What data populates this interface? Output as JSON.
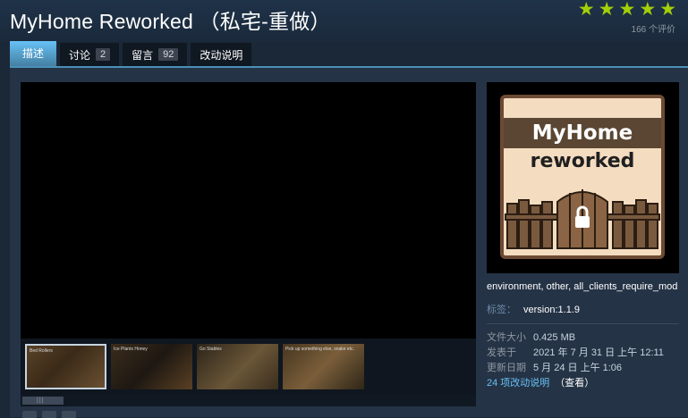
{
  "title": "MyHome Reworked （私宅-重做）",
  "rating": {
    "stars": 5,
    "count_text": "166 个评价",
    "star_color": "#a3cf06"
  },
  "tabs": [
    {
      "label": "描述",
      "active": true
    },
    {
      "label": "讨论",
      "count": "2"
    },
    {
      "label": "留言",
      "count": "92"
    },
    {
      "label": "改动说明"
    }
  ],
  "media": {
    "thumbnails": [
      {
        "caption": "Bed Rollers"
      },
      {
        "caption": "Ice Plants Honey"
      },
      {
        "caption": "Go Stables"
      },
      {
        "caption": "Pick up something else, snake etc."
      }
    ]
  },
  "preview": {
    "logo_line1": "MyHome",
    "logo_line2": "reworked"
  },
  "tags": {
    "list_text": "environment, other, all_clients_require_mod",
    "label": "标签：",
    "value": "version:1.1.9"
  },
  "stats": [
    {
      "key": "文件大小",
      "value": "0.425 MB"
    },
    {
      "key": "发表于",
      "value": "2021 年 7 月 31 日 上午 12:11"
    },
    {
      "key": "更新日期",
      "value": "5 月 24 日 上午 1:06"
    }
  ],
  "changes": {
    "link": "24 项改动说明",
    "view": "（查看）"
  },
  "colors": {
    "background": "#1b2838",
    "accent": "#67c1f5"
  }
}
